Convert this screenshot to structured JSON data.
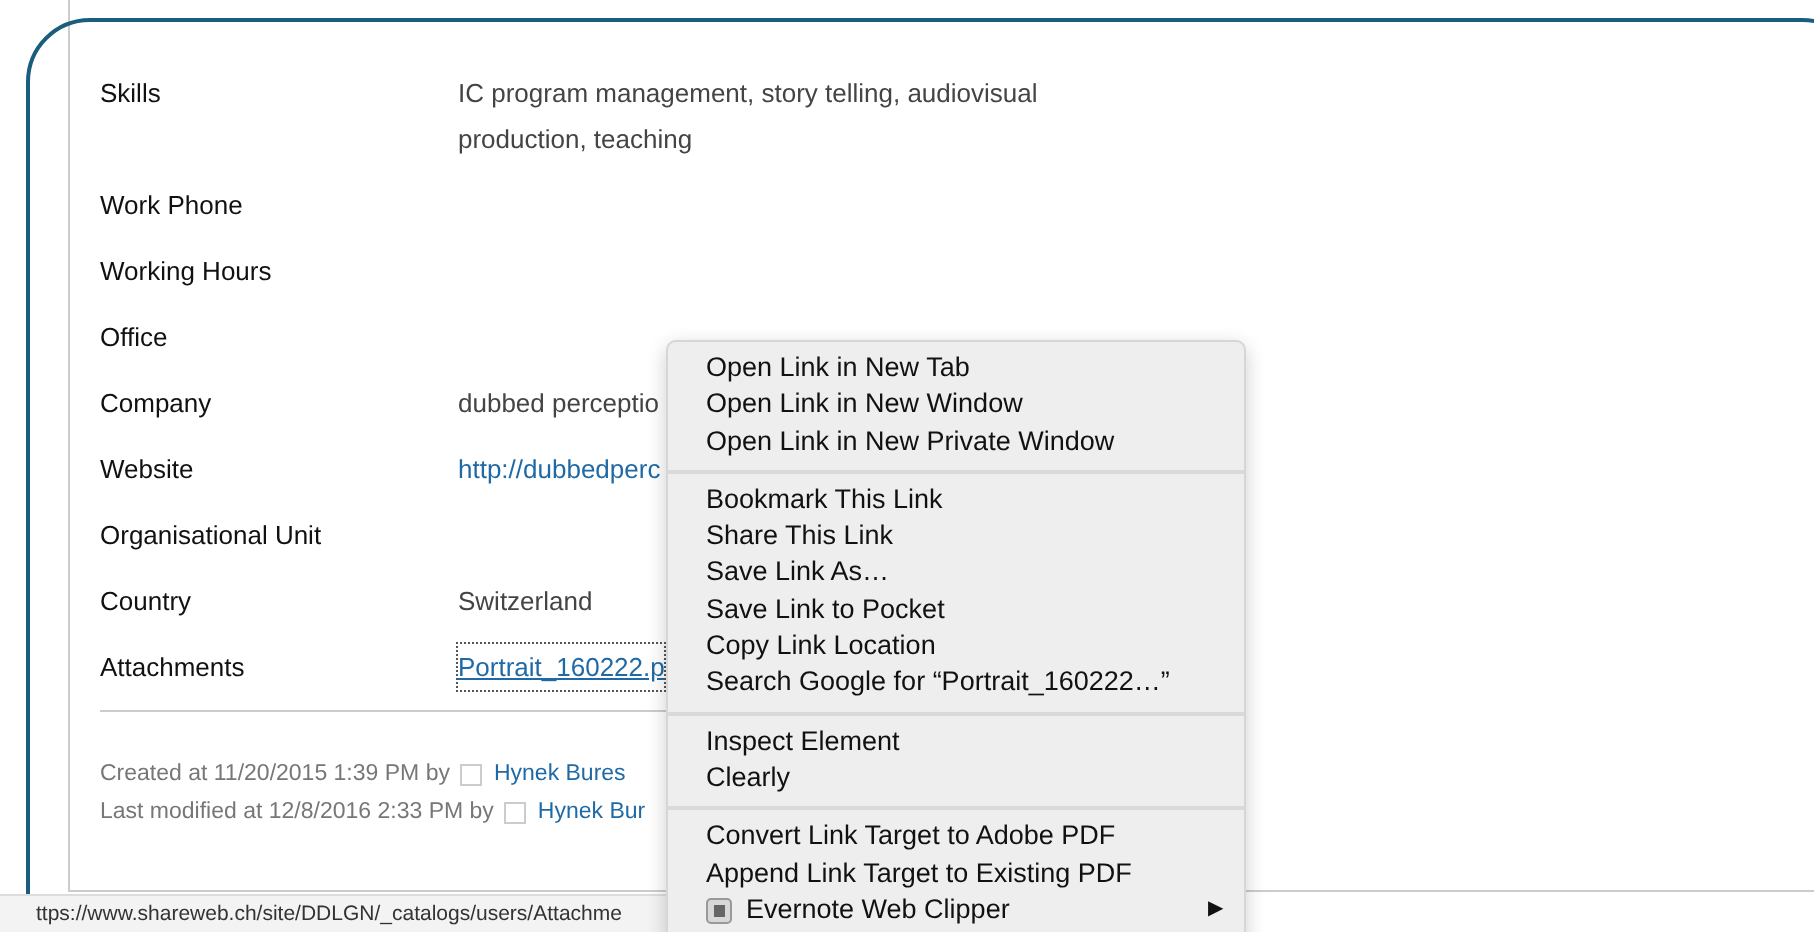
{
  "fields": [
    {
      "label": "Skills",
      "value": "IC program management, story telling, audiovisual production, teaching",
      "kind": "text"
    },
    {
      "label": "Work Phone"
    },
    {
      "label": "Working Hours"
    },
    {
      "label": "Office"
    },
    {
      "label": "Company",
      "value": "dubbed perceptio",
      "kind": "text"
    },
    {
      "label": "Website",
      "value": "http://dubbedperc",
      "kind": "link"
    },
    {
      "label": "Organisational Unit"
    },
    {
      "label": "Country",
      "value": "Switzerland",
      "kind": "text"
    },
    {
      "label": "Attachments",
      "value": "Portrait_160222.p",
      "kind": "focused-link"
    }
  ],
  "footer": [
    {
      "text": "Created at 11/20/2015 1:39 PM by",
      "user": "Hynek Bures"
    },
    {
      "text": "Last modified at 12/8/2016 2:33 PM by",
      "user": "Hynek Bur"
    }
  ],
  "context_menu": [
    {
      "kind": "item",
      "label": "Open Link in New Tab"
    },
    {
      "kind": "item",
      "label": "Open Link in New Window"
    },
    {
      "kind": "item",
      "label": "Open Link in New Private Window"
    },
    {
      "kind": "separator"
    },
    {
      "kind": "item",
      "label": "Bookmark This Link"
    },
    {
      "kind": "item",
      "label": "Share This Link"
    },
    {
      "kind": "item",
      "label": "Save Link As…"
    },
    {
      "kind": "item",
      "label": "Save Link to Pocket"
    },
    {
      "kind": "item",
      "label": "Copy Link Location"
    },
    {
      "kind": "item",
      "label": "Search Google for “Portrait_160222…”"
    },
    {
      "kind": "separator"
    },
    {
      "kind": "item",
      "label": "Inspect Element"
    },
    {
      "kind": "item",
      "label": "Clearly"
    },
    {
      "kind": "separator"
    },
    {
      "kind": "item",
      "label": "Convert Link Target to Adobe PDF"
    },
    {
      "kind": "item",
      "label": "Append Link Target to Existing PDF"
    },
    {
      "kind": "submenu",
      "label": "Evernote Web Clipper",
      "arrow": "▶"
    }
  ],
  "status_bar": {
    "url": "ttps://www.shareweb.ch/site/DDLGN/_catalogs/users/Attachme"
  }
}
